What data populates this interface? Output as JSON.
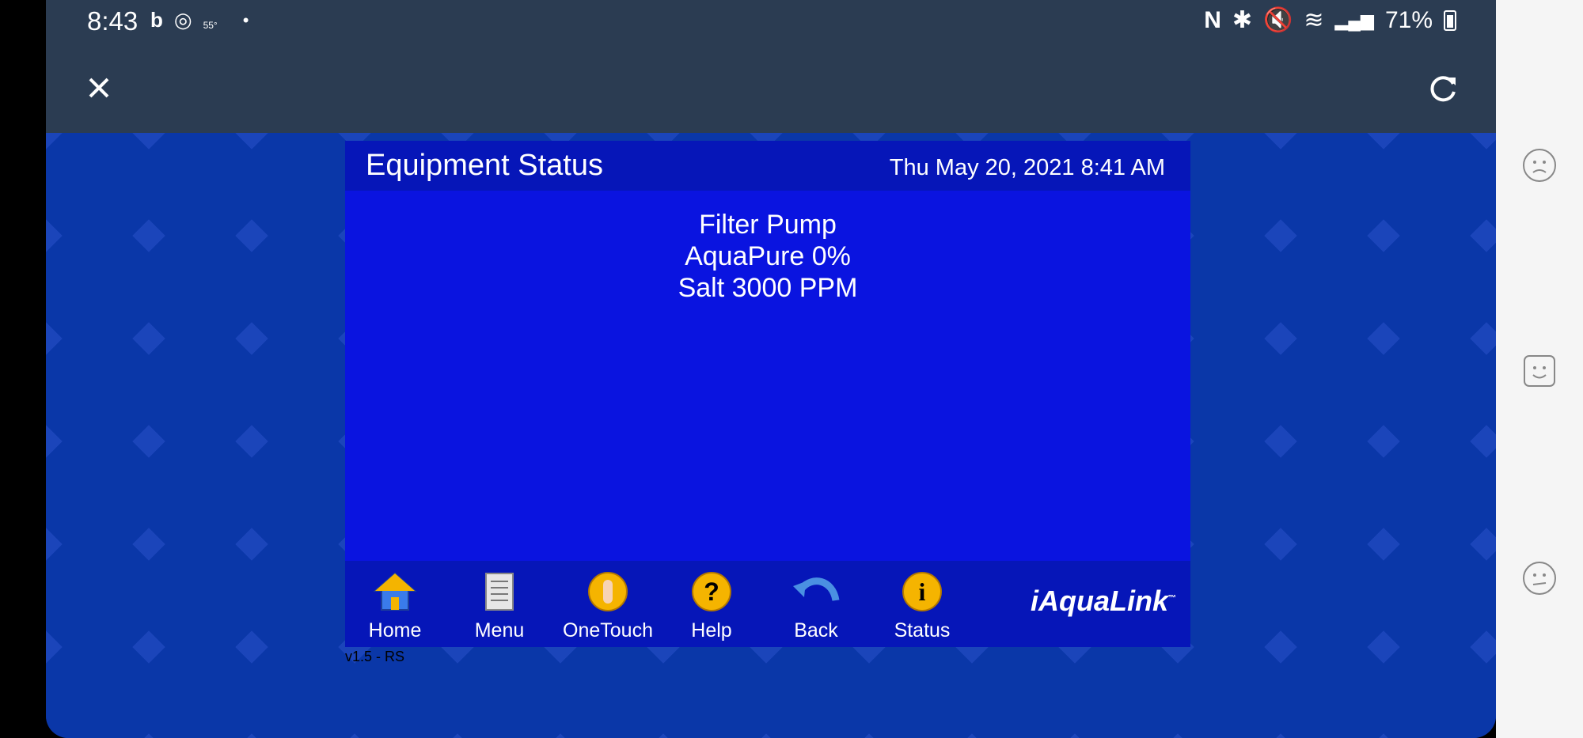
{
  "status_bar": {
    "time": "8:43",
    "temp": "55°",
    "battery": "71%",
    "icons": [
      "bing-icon",
      "assistant-icon",
      "nfc-icon",
      "bluetooth-icon",
      "mute-icon",
      "wifi-icon",
      "signal-icon",
      "battery-icon"
    ]
  },
  "app_bar": {
    "close_icon": "close-icon",
    "refresh_icon": "refresh-icon"
  },
  "panel": {
    "title": "Equipment Status",
    "datetime": "Thu May 20, 2021 8:41 AM",
    "lines": [
      "Filter Pump",
      "AquaPure 0%",
      "Salt 3000 PPM"
    ]
  },
  "toolbar": {
    "items": [
      {
        "label": "Home",
        "icon": "home-icon"
      },
      {
        "label": "Menu",
        "icon": "menu-icon"
      },
      {
        "label": "OneTouch",
        "icon": "onetouch-icon"
      },
      {
        "label": "Help",
        "icon": "help-icon"
      },
      {
        "label": "Back",
        "icon": "back-icon"
      },
      {
        "label": "Status",
        "icon": "status-icon"
      }
    ],
    "brand": "iAquaLink"
  },
  "version": "v1.5 - RS",
  "feedback": {
    "options": [
      "unhappy-face-icon",
      "happy-face-icon",
      "neutral-face-icon"
    ]
  },
  "colors": {
    "app_bar": "#2b3c52",
    "panel_body": "#0a14e0",
    "panel_header": "#0616b8",
    "page_bg": "#0a37a8"
  }
}
